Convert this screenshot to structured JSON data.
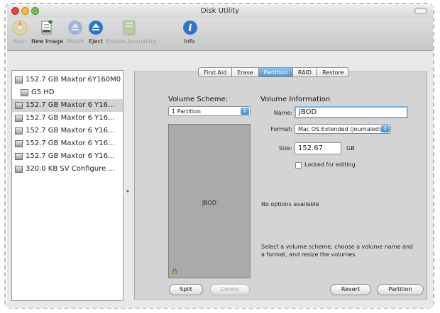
{
  "window": {
    "title": "Disk Utility"
  },
  "toolbar": [
    {
      "id": "burn",
      "label": "Burn",
      "icon": "burn-icon",
      "enabled": false
    },
    {
      "id": "new-image",
      "label": "New Image",
      "icon": "new-image-icon",
      "enabled": true
    },
    {
      "id": "mount",
      "label": "Mount",
      "icon": "mount-icon",
      "enabled": false
    },
    {
      "id": "eject",
      "label": "Eject",
      "icon": "eject-icon",
      "enabled": true
    },
    {
      "id": "enable-journaling",
      "label": "Enable Journaling",
      "icon": "journaling-icon",
      "enabled": false
    },
    {
      "id": "info",
      "label": "Info",
      "icon": "info-icon",
      "enabled": true
    }
  ],
  "disks": [
    {
      "label": "152.7 GB Maxtor 6Y160M0",
      "level": 0,
      "selected": false
    },
    {
      "label": "G5 HD",
      "level": 1,
      "selected": false
    },
    {
      "label": "152.7 GB Maxtor 6 Y16...",
      "level": 0,
      "selected": true
    },
    {
      "label": "152.7 GB Maxtor 6 Y16...",
      "level": 0,
      "selected": false
    },
    {
      "label": "152.7 GB Maxtor 6 Y16...",
      "level": 0,
      "selected": false
    },
    {
      "label": "152.7 GB Maxtor 6 Y16...",
      "level": 0,
      "selected": false
    },
    {
      "label": "152.7 GB Maxtor 6 Y16...",
      "level": 0,
      "selected": false
    },
    {
      "label": "320.0 KB SV Configure ...",
      "level": 0,
      "selected": false
    }
  ],
  "tabs": [
    {
      "label": "First Aid",
      "active": false
    },
    {
      "label": "Erase",
      "active": false
    },
    {
      "label": "Partition",
      "active": true
    },
    {
      "label": "RAID",
      "active": false
    },
    {
      "label": "Restore",
      "active": false
    }
  ],
  "scheme": {
    "title": "Volume Scheme:",
    "selected": "1 Partition",
    "partition_label": "JBOD"
  },
  "volume_info": {
    "title": "Volume Information",
    "name_label": "Name:",
    "name_value": "JBOD",
    "format_label": "Format:",
    "format_value": "Mac OS Extended (Journaled)",
    "size_label": "Size:",
    "size_value": "152.67",
    "size_unit": "GB",
    "locked_label": "Locked for editing",
    "locked": false,
    "options_text": "No options available",
    "help_text": "Select a volume scheme, choose a volume name and a format, and resize the volumes."
  },
  "buttons": {
    "split": "Split",
    "delete": "Delete",
    "revert": "Revert",
    "partition": "Partition"
  },
  "colors": {
    "accent": "#4f93d8",
    "selection": "#d4d4d4",
    "scheme_fill": "#aaaaaa"
  }
}
